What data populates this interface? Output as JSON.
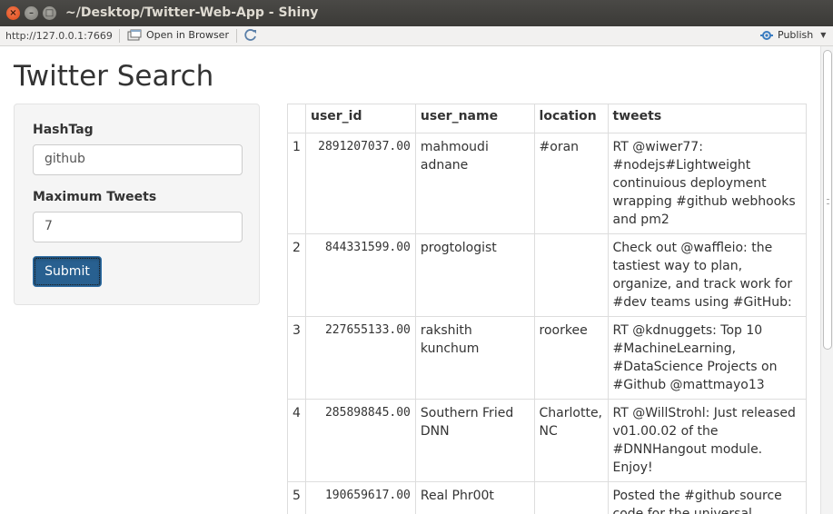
{
  "window": {
    "title": "~/Desktop/Twitter-Web-App - Shiny",
    "close_glyph": "×",
    "min_glyph": "–",
    "max_glyph": "□"
  },
  "toolbar": {
    "url": "http://127.0.0.1:7669",
    "open_in_browser": "Open in Browser",
    "publish": "Publish"
  },
  "page": {
    "title": "Twitter Search"
  },
  "form": {
    "hashtag_label": "HashTag",
    "hashtag_value": "github",
    "max_label": "Maximum Tweets",
    "max_value": "7",
    "submit_label": "Submit"
  },
  "table": {
    "headers": [
      "",
      "user_id",
      "user_name",
      "location",
      "tweets"
    ],
    "rows": [
      {
        "idx": "1",
        "user_id": "2891207037.00",
        "user_name": "mahmoudi adnane",
        "location": "#oran",
        "tweets": "RT @wiwer77: #nodejs#Lightweight continuious deployment wrapping #github webhooks and pm2"
      },
      {
        "idx": "2",
        "user_id": "844331599.00",
        "user_name": "progtologist",
        "location": "",
        "tweets": "Check out @waffleio: the tastiest way to plan, organize, and track work for #dev teams using #GitHub:"
      },
      {
        "idx": "3",
        "user_id": "227655133.00",
        "user_name": "rakshith kunchum",
        "location": "roorkee",
        "tweets": "RT @kdnuggets: Top 10 #MachineLearning, #DataScience Projects on #Github @mattmayo13"
      },
      {
        "idx": "4",
        "user_id": "285898845.00",
        "user_name": "Southern Fried DNN",
        "location": "Charlotte, NC",
        "tweets": "RT @WillStrohl: Just released v01.00.02 of the #DNNHangout module. Enjoy!"
      },
      {
        "idx": "5",
        "user_id": "190659617.00",
        "user_name": "Real Phr00t",
        "location": "",
        "tweets": "Posted the #github source code for the universal"
      }
    ]
  },
  "colors": {
    "primary": "#337ab7",
    "titlebar": "#3c3b37"
  }
}
